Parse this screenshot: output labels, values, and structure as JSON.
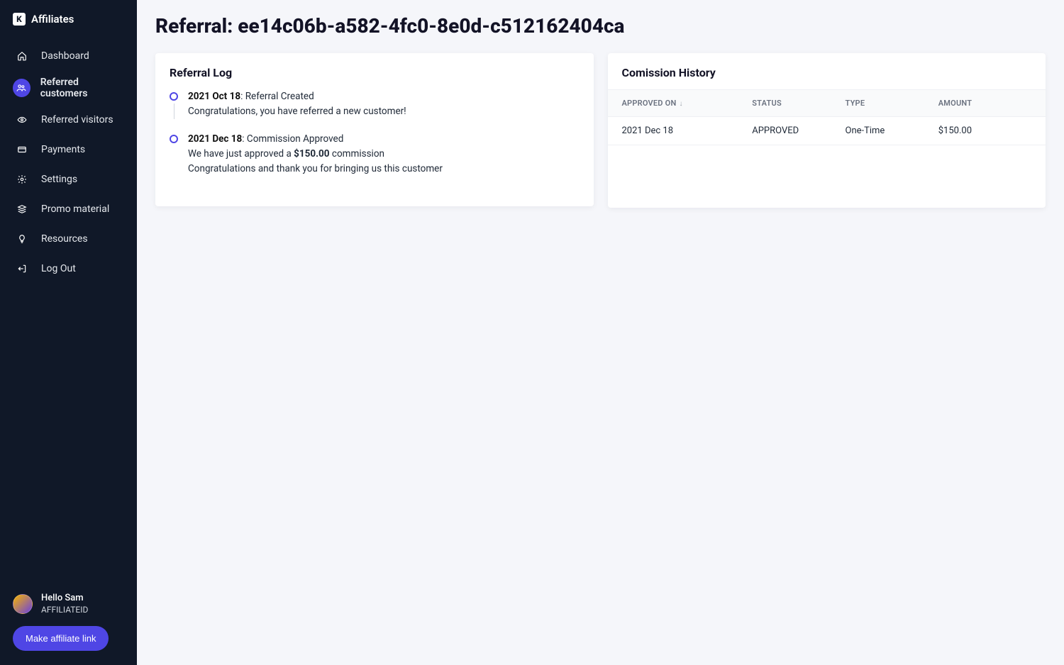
{
  "brand": {
    "logo_letter": "K",
    "name": "Affiliates"
  },
  "sidebar": {
    "items": [
      {
        "label": "Dashboard",
        "icon": "home",
        "active": false
      },
      {
        "label": "Referred customers",
        "icon": "users",
        "active": true
      },
      {
        "label": "Referred visitors",
        "icon": "eye",
        "active": false
      },
      {
        "label": "Payments",
        "icon": "card",
        "active": false
      },
      {
        "label": "Settings",
        "icon": "gear",
        "active": false
      },
      {
        "label": "Promo material",
        "icon": "stack",
        "active": false
      },
      {
        "label": "Resources",
        "icon": "bulb",
        "active": false
      },
      {
        "label": "Log Out",
        "icon": "logout",
        "active": false
      }
    ],
    "user": {
      "greeting": "Hello Sam",
      "affiliate_id": "AFFILIATEID"
    },
    "cta_label": "Make affiliate link"
  },
  "page": {
    "title": "Referral: ee14c06b-a582-4fc0-8e0d-c512162404ca"
  },
  "referral_log": {
    "heading": "Referral Log",
    "items": [
      {
        "date": "2021 Oct 18",
        "title": "Referral Created",
        "body1": "Congratulations, you have referred a new customer!",
        "body2": ""
      },
      {
        "date": "2021 Dec 18",
        "title": "Commission Approved",
        "body1_prefix": "We have just approved a ",
        "body1_amount": "$150.00",
        "body1_suffix": " commission",
        "body2": "Congratulations and thank you for bringing us this customer"
      }
    ]
  },
  "commission": {
    "heading": "Comission History",
    "columns": {
      "approved_on": "Approved On",
      "status": "Status",
      "type": "Type",
      "amount": "Amount"
    },
    "rows": [
      {
        "approved_on": "2021 Dec 18",
        "status": "APPROVED",
        "type": "One-Time",
        "amount": "$150.00"
      }
    ]
  }
}
